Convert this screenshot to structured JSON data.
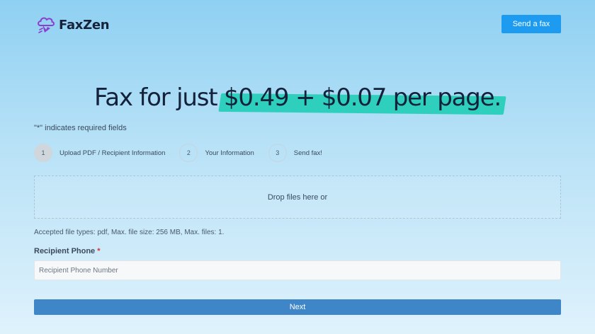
{
  "header": {
    "brand": "FaxZen",
    "logo_icon": "cloud-fax-icon",
    "send_button_label": "Send a fax"
  },
  "hero": {
    "title_prefix": "Fax for just ",
    "title_highlight": "$0.49 + $0.07 per page."
  },
  "form": {
    "required_star": "\"*\"",
    "required_note": " indicates required fields",
    "steps": [
      {
        "number": "1",
        "label": "Upload PDF / Recipient Information",
        "active": true
      },
      {
        "number": "2",
        "label": "Your Information",
        "active": false
      },
      {
        "number": "3",
        "label": "Send fax!",
        "active": false
      }
    ],
    "dropzone_text": "Drop files here or",
    "accepted_text": "Accepted file types: pdf, Max. file size: 256 MB, Max. files: 1.",
    "phone_label": "Recipient Phone",
    "phone_required_mark": "*",
    "phone_placeholder": "Recipient Phone Number",
    "phone_value": "",
    "next_label": "Next"
  },
  "colors": {
    "primary_button": "#1d9bf0",
    "next_button": "#3f86c9",
    "highlight": "#2fcfbd",
    "logo_accent": "#8a3fd1",
    "required_star": "#d63031"
  }
}
